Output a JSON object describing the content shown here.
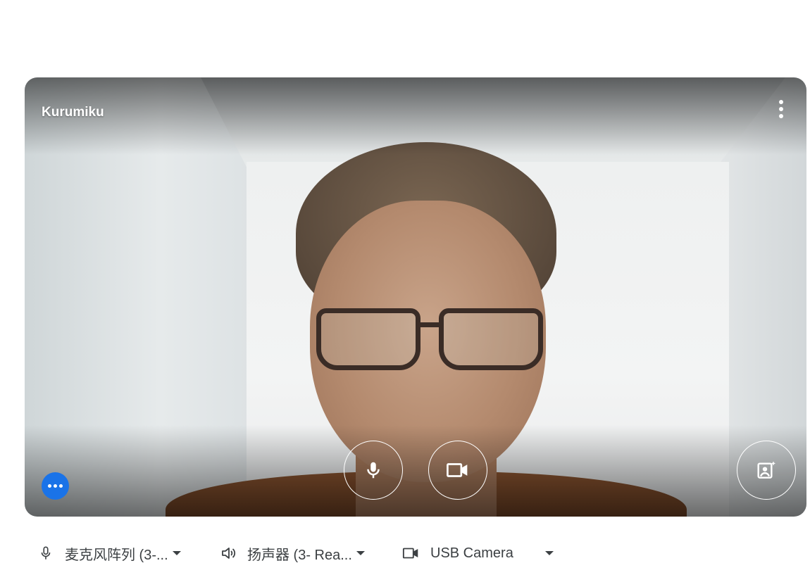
{
  "preview": {
    "participant_name": "Kurumiku"
  },
  "controls": {
    "mic_icon": "mic-icon",
    "camera_icon": "videocam-icon",
    "effects_icon": "visual-effects-icon",
    "more_icon": "more-vert-icon",
    "dots_icon": "more-horiz-icon",
    "accent_color": "#1a73e8"
  },
  "devices": {
    "microphone": {
      "icon": "mic-icon",
      "label": "麦克风阵列 (3-..."
    },
    "speaker": {
      "icon": "volume-up-icon",
      "label": "扬声器 (3- Rea..."
    },
    "camera": {
      "icon": "videocam-icon",
      "label": "USB Camera"
    }
  }
}
